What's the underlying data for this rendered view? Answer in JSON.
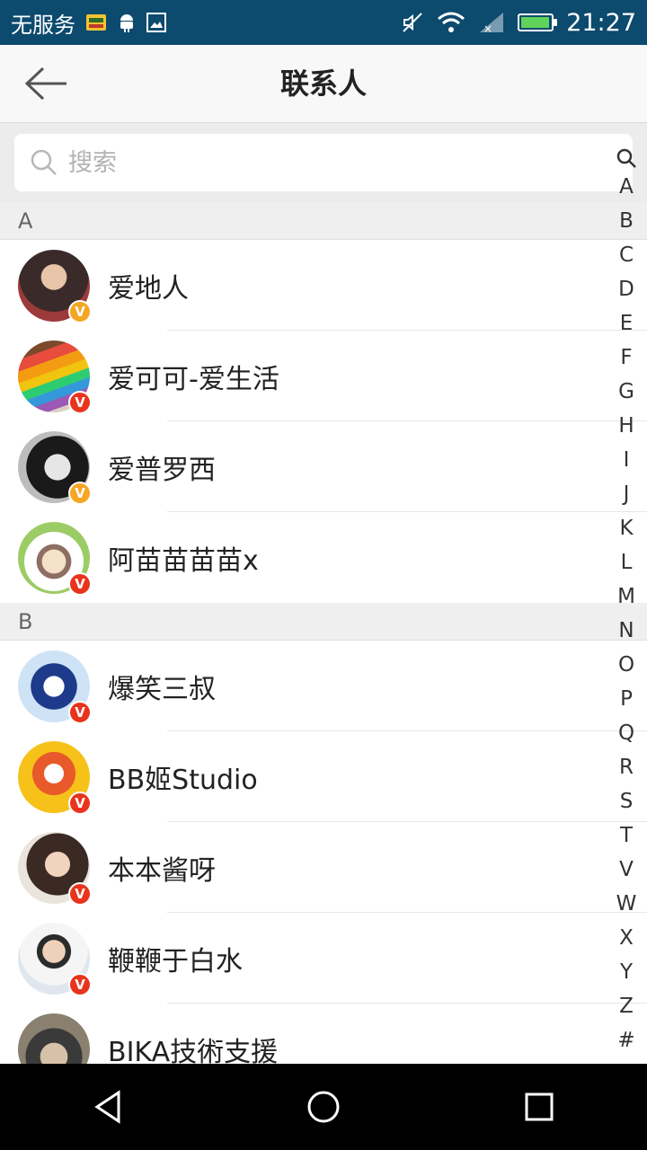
{
  "status_bar": {
    "carrier": "无服务",
    "time": "21:27",
    "icons": [
      "sim-icon",
      "android-icon",
      "image-icon",
      "mute-icon",
      "wifi-icon",
      "signal-icon",
      "battery-charging-icon"
    ],
    "battery_level": 0.85
  },
  "header": {
    "title": "联系人",
    "back_icon": "arrow-left-icon"
  },
  "search": {
    "placeholder": "搜索",
    "value": ""
  },
  "sections": [
    {
      "letter": "A",
      "contacts": [
        {
          "name": "爱地人",
          "badge": "V",
          "badge_color": "#f5a623"
        },
        {
          "name": "爱可可-爱生活",
          "badge": "V",
          "badge_color": "#e8341c"
        },
        {
          "name": "爱普罗西",
          "badge": "V",
          "badge_color": "#f5a623"
        },
        {
          "name": "阿苗苗苗苗x",
          "badge": "V",
          "badge_color": "#e8341c"
        }
      ]
    },
    {
      "letter": "B",
      "contacts": [
        {
          "name": "爆笑三叔",
          "badge": "V",
          "badge_color": "#e8341c"
        },
        {
          "name": "BB姬Studio",
          "badge": "V",
          "badge_color": "#e8341c"
        },
        {
          "name": "本本酱呀",
          "badge": "V",
          "badge_color": "#e8341c"
        },
        {
          "name": "鞭鞭于白水",
          "badge": "V",
          "badge_color": "#e8341c"
        },
        {
          "name": "BIKA技術支援",
          "badge": "V",
          "badge_color": "#e8341c"
        }
      ]
    }
  ],
  "index_letters": [
    "A",
    "B",
    "C",
    "D",
    "E",
    "F",
    "G",
    "H",
    "I",
    "J",
    "K",
    "L",
    "M",
    "N",
    "O",
    "P",
    "Q",
    "R",
    "S",
    "T",
    "V",
    "W",
    "X",
    "Y",
    "Z",
    "#"
  ],
  "nav_bar": {
    "buttons": [
      "back-triangle-icon",
      "home-circle-icon",
      "recents-square-icon"
    ]
  },
  "colors": {
    "status_bar": "#0c4a6e",
    "badge_gold": "#f5a623",
    "badge_red": "#e8341c"
  }
}
